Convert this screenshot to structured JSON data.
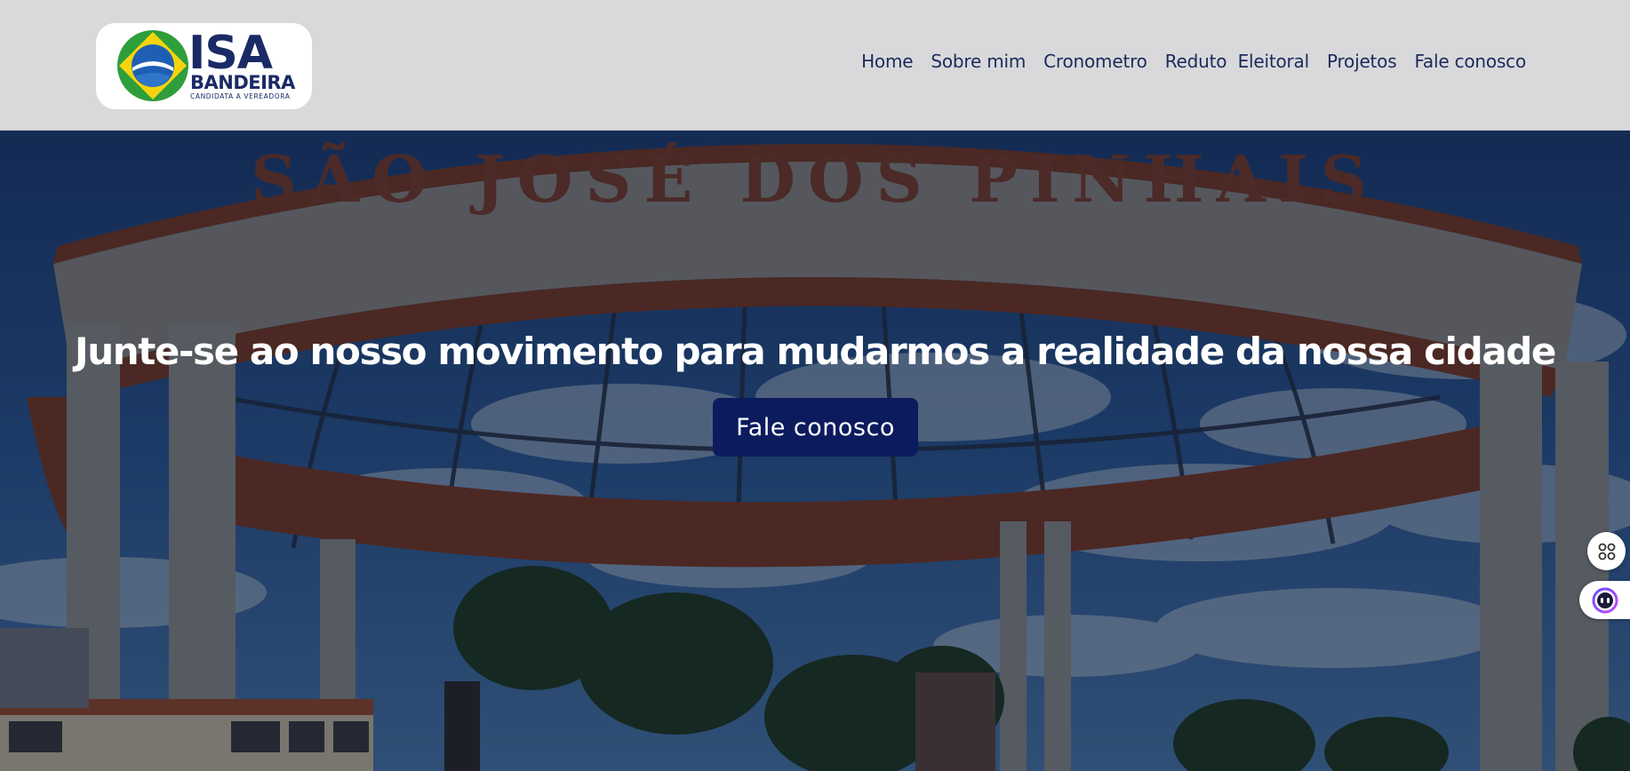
{
  "logo": {
    "name": "ISA",
    "surname": "BANDEIRA",
    "tagline": "CANDIDATA A VEREADORA"
  },
  "nav": {
    "items": [
      {
        "label": "Home"
      },
      {
        "label": "Sobre mim"
      },
      {
        "label": "Cronometro"
      },
      {
        "label": "Reduto  Eleitoral"
      },
      {
        "label": "Projetos"
      },
      {
        "label": "Fale conosco"
      }
    ]
  },
  "hero": {
    "sign_text": "SÃO JOSÉ DOS PINHAIS",
    "headline": "Junte-se ao nosso movimento para mudarmos a realidade da nossa cidade",
    "cta_label": "Fale conosco"
  },
  "widgets": {
    "apps_icon": "apps-grid-icon",
    "assistant_icon": "assistant-bot-icon"
  },
  "colors": {
    "header_bg": "#d9d9db",
    "nav_text": "#1b2a5c",
    "cta_bg": "#0c1b5e",
    "brand_navy": "#1a2a66",
    "brand_yellow": "#f5d40f",
    "brand_green": "#2e9e3a"
  }
}
